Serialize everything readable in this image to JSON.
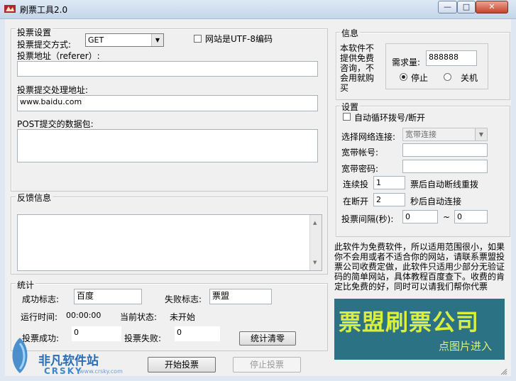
{
  "window": {
    "title": "刷票工具2.0",
    "min": "—",
    "max": "□",
    "close": "✕"
  },
  "vote_settings": {
    "group_title": "投票设置",
    "method_label": "投票提交方式:",
    "method_value": "GET",
    "utf8_label": "网站是UTF-8编码",
    "referer_label": "投票地址（referer）:",
    "referer_value": "",
    "handler_label": "投票提交处理地址:",
    "handler_value": "www.baidu.com",
    "post_label": "POST提交的数据包:",
    "post_value": ""
  },
  "feedback": {
    "group_title": "反馈信息",
    "content": ""
  },
  "stats": {
    "group_title": "统计",
    "success_flag_label": "成功标志:",
    "success_flag_value": "百度",
    "fail_flag_label": "失败标志:",
    "fail_flag_value": "票盟",
    "run_time_label": "运行时间:",
    "run_time_value": "00:00:00",
    "status_label": "当前状态:",
    "status_value": "未开始",
    "success_count_label": "投票成功:",
    "success_count_value": "0",
    "fail_count_label": "投票失败:",
    "fail_count_value": "0",
    "clear_button": "统计清零"
  },
  "actions": {
    "start": "开始投票",
    "stop": "停止投票"
  },
  "info": {
    "group_title": "信息",
    "note_lines": [
      "本软件不",
      "提供免费",
      "咨询，不",
      "会用就购",
      "买"
    ],
    "demand_label": "需求量:",
    "demand_value": "888888",
    "radio_stop": "停止",
    "radio_shutdown": "关机"
  },
  "settings": {
    "group_title": "设置",
    "auto_redial_label": "自动循环拨号/断开",
    "network_label": "选择网络连接:",
    "network_value": "宽带连接",
    "account_label": "宽带帐号:",
    "account_value": "",
    "password_label": "宽带密码:",
    "password_value": "",
    "consecutive_label": "连续投",
    "consecutive_value": "1",
    "consecutive_suffix": "票后自动断线重拨",
    "reconnect_label": "在断开",
    "reconnect_value": "2",
    "reconnect_suffix": "秒后自动连接",
    "interval_label": "投票间隔(秒):",
    "interval_from": "0",
    "interval_sep": "~",
    "interval_to": "0"
  },
  "description": "此软件为免费软件，所以适用范围很小，如果你不会用或者不适合你的网站，请联系票盟投票公司收费定做，此软件只适用少部分无验证码的简单网站，具体教程百度查下。收费的肯定比免费的好，同时可以请我们帮你代票",
  "banner": {
    "main": "票盟刷票公司",
    "sub": "点图片进入"
  },
  "watermark": {
    "name": "非凡软件站",
    "brand": "CRSKY",
    "domain": "www.crsky.com"
  }
}
